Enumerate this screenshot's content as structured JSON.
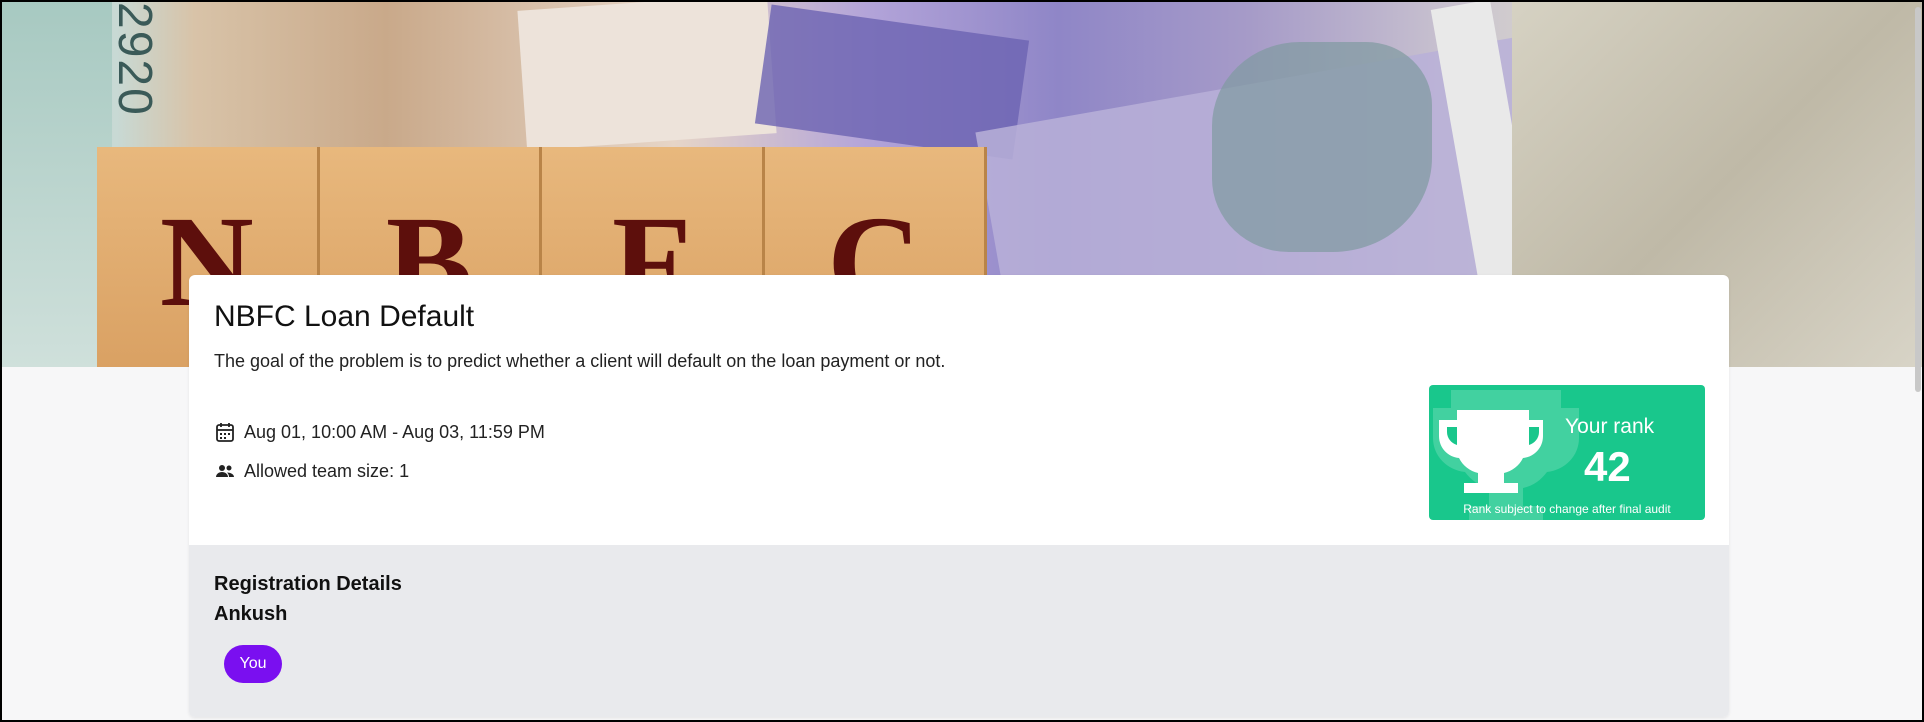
{
  "banner": {
    "letters": [
      "N",
      "B",
      "F",
      "C"
    ],
    "note_number": "2920"
  },
  "contest": {
    "title": "NBFC Loan Default",
    "description": "The goal of the problem is to predict whether a client will default on the loan payment or not.",
    "dates": "Aug 01, 10:00 AM - Aug 03, 11:59 PM",
    "team_size": "Allowed team size: 1"
  },
  "rank": {
    "label": "Your rank",
    "value": "42",
    "note": "Rank subject to change after final audit",
    "color": "#19c78c"
  },
  "registration": {
    "title": "Registration Details",
    "name": "Ankush",
    "badge": "You",
    "badge_color": "#7a0ff0"
  },
  "icons": {
    "date": "calendar-icon",
    "team": "people-icon",
    "rank": "trophy-icon"
  }
}
